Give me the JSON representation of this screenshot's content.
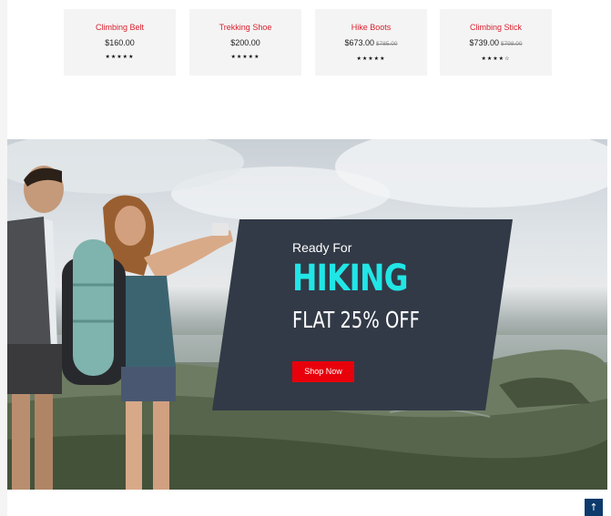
{
  "products": [
    {
      "name": "Climbing Belt",
      "price": "$160.00",
      "old_price": "",
      "stars": "★★★★★"
    },
    {
      "name": "Trekking Shoe",
      "price": "$200.00",
      "old_price": "",
      "stars": "★★★★★"
    },
    {
      "name": "Hike Boots",
      "price": "$673.00",
      "old_price": "$785.00",
      "stars": "★★★★★"
    },
    {
      "name": "Climbing Stick",
      "price": "$739.00",
      "old_price": "$798.00",
      "stars": "★★★★☆"
    }
  ],
  "banner": {
    "subtitle": "Ready For",
    "title": "HIKING",
    "offer": "FLAT 25% OFF",
    "cta_label": "Shop Now"
  },
  "scroll_top": {
    "icon": "arrow-up-icon",
    "glyph": "↑"
  },
  "colors": {
    "product_name": "#d9202e",
    "hiking_accent": "#21e6e6",
    "cta": "#e8000b",
    "promo_panel": "#323a47",
    "scroll_top": "#0b3a6b"
  }
}
